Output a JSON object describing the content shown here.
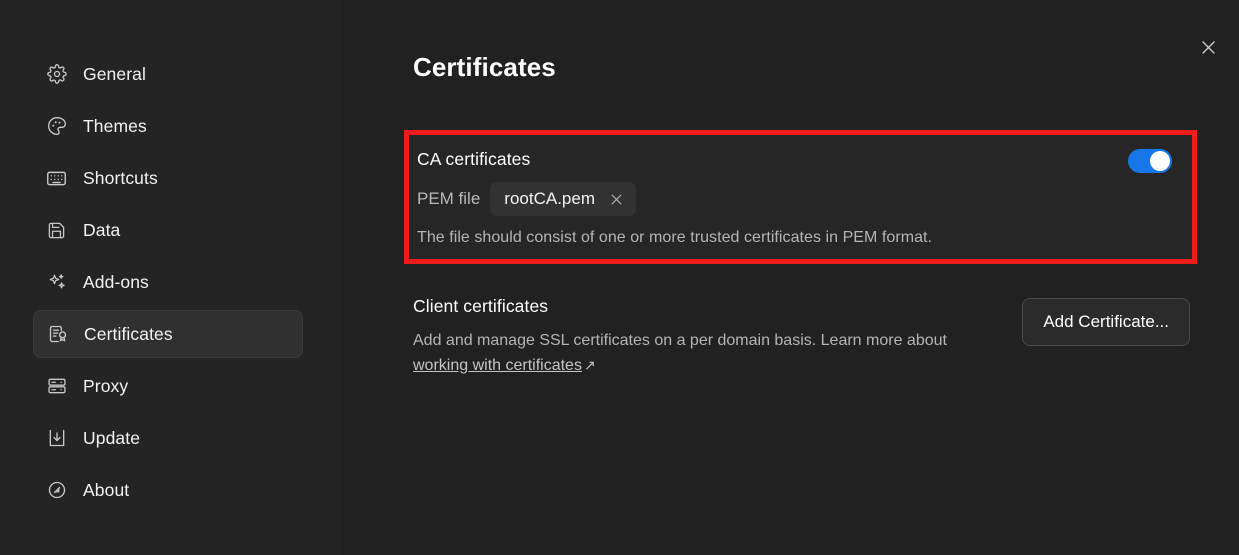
{
  "sidebar": {
    "items": [
      {
        "label": "General",
        "icon": "gear-icon",
        "selected": false
      },
      {
        "label": "Themes",
        "icon": "palette-icon",
        "selected": false
      },
      {
        "label": "Shortcuts",
        "icon": "keyboard-icon",
        "selected": false
      },
      {
        "label": "Data",
        "icon": "floppy-disk-icon",
        "selected": false
      },
      {
        "label": "Add-ons",
        "icon": "sparkles-icon",
        "selected": false
      },
      {
        "label": "Certificates",
        "icon": "certificate-icon",
        "selected": true
      },
      {
        "label": "Proxy",
        "icon": "server-icon",
        "selected": false
      },
      {
        "label": "Update",
        "icon": "download-icon",
        "selected": false
      },
      {
        "label": "About",
        "icon": "info-circle-icon",
        "selected": false
      }
    ]
  },
  "header": {
    "title": "Certificates",
    "close_icon": "close-icon"
  },
  "ca_certificates": {
    "title": "CA certificates",
    "toggle_on": true,
    "toggle_color": "#1877e8",
    "highlight_color": "#ee1c1c",
    "pem_label": "PEM file",
    "pem_file_name": "rootCA.pem",
    "pem_remove_icon": "close-icon",
    "hint": "The file should consist of one or more trusted certificates in PEM format."
  },
  "client_certificates": {
    "title": "Client certificates",
    "description_before": "Add and manage SSL certificates on a per domain basis. Learn more about ",
    "link_text": "working with certificates",
    "external_link_icon": "external-link-arrow",
    "add_button_label": "Add Certificate..."
  }
}
